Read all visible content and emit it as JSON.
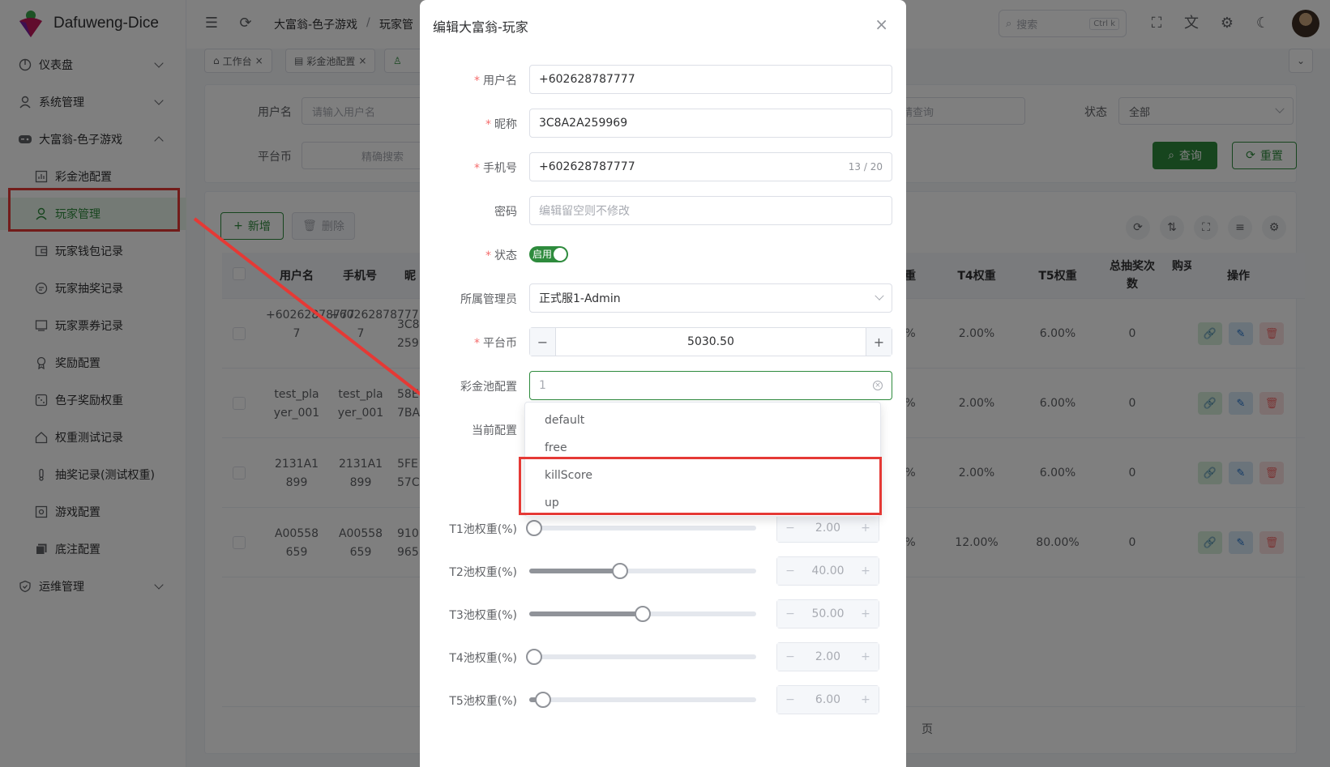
{
  "app": {
    "title": "Dafuweng-Dice"
  },
  "sidebar": {
    "items": [
      {
        "label": "仪表盘",
        "icon": "dashboard-icon"
      },
      {
        "label": "系统管理",
        "icon": "user-icon"
      },
      {
        "label": "大富翁-色子游戏",
        "icon": "gamepad-icon"
      },
      {
        "label": "彩金池配置",
        "icon": "chart-icon"
      },
      {
        "label": "玩家管理",
        "icon": "user-icon"
      },
      {
        "label": "玩家钱包记录",
        "icon": "wallet-icon"
      },
      {
        "label": "玩家抽奖记录",
        "icon": "record-icon"
      },
      {
        "label": "玩家票券记录",
        "icon": "ticket-icon"
      },
      {
        "label": "奖励配置",
        "icon": "award-icon"
      },
      {
        "label": "色子奖励权重",
        "icon": "dice-icon"
      },
      {
        "label": "权重测试记录",
        "icon": "home-icon"
      },
      {
        "label": "抽奖记录(测试权重)",
        "icon": "thermometer-icon"
      },
      {
        "label": "游戏配置",
        "icon": "settings-icon"
      },
      {
        "label": "底注配置",
        "icon": "copy-icon"
      },
      {
        "label": "运维管理",
        "icon": "shield-icon"
      }
    ]
  },
  "header": {
    "breadcrumb": [
      "大富翁-色子游戏",
      "/",
      "玩家管"
    ],
    "search_placeholder": "搜索",
    "search_shortcut": "Ctrl k"
  },
  "tabs": [
    {
      "label": "工作台"
    },
    {
      "label": "彩金池配置"
    }
  ],
  "filters": {
    "username_label": "用户名",
    "username_placeholder": "请输入用户名",
    "hidden_placeholder": "精查询",
    "status_label": "状态",
    "status_value": "全部",
    "coin_label": "平台币",
    "coin_placeholder": "精确搜索",
    "query_button": "查询",
    "reset_button": "重置"
  },
  "toolbar": {
    "add_button": "新增",
    "delete_button": "删除"
  },
  "table": {
    "headers": {
      "username": "用户名",
      "phone": "手机号",
      "nick": "昵",
      "w3": "重",
      "t4": "T4权重",
      "t5": "T5权重",
      "total": "总抽奖次数",
      "buy": "购买",
      "ops": "操作"
    },
    "rows": [
      {
        "username": "+60262878777\n7",
        "phone": "+60262878777\n7",
        "nick": "3C8\n259",
        "w3": "%",
        "t4": "2.00%",
        "t5": "6.00%",
        "total": "0"
      },
      {
        "username": "test_pla\nyer_001",
        "phone": "test_pla\nyer_001",
        "nick": "58E\n7BA",
        "w3": "%",
        "t4": "2.00%",
        "t5": "6.00%",
        "total": "0"
      },
      {
        "username": "2131A1\n899",
        "phone": "2131A1\n899",
        "nick": "5FE\n57C",
        "w3": "%",
        "t4": "2.00%",
        "t5": "6.00%",
        "total": "0"
      },
      {
        "username": "A00558\n659",
        "phone": "A00558\n659",
        "nick": "910\n965",
        "w3": "%",
        "t4": "12.00%",
        "t5": "80.00%",
        "total": "0"
      }
    ],
    "pager_suffix": "页"
  },
  "dialog": {
    "title": "编辑大富翁-玩家",
    "username_label": "用户名",
    "username_value": "+602628787777",
    "nickname_label": "昵称",
    "nickname_value": "3C8A2A259969",
    "phone_label": "手机号",
    "phone_value": "+602628787777",
    "phone_counter": "13 / 20",
    "password_label": "密码",
    "password_placeholder": "编辑留空则不修改",
    "status_label": "状态",
    "status_switch_text": "启用",
    "admin_label": "所属管理员",
    "admin_value": "正式服1-Admin",
    "coin_label": "平台币",
    "coin_value": "5030.50",
    "jackpot_label": "彩金池配置",
    "jackpot_value": "1",
    "current_label": "当前配置",
    "sliders": [
      {
        "label": "T1池权重(%)",
        "value": "2.00",
        "fraction": 0.02
      },
      {
        "label": "T2池权重(%)",
        "value": "40.00",
        "fraction": 0.4
      },
      {
        "label": "T3池权重(%)",
        "value": "50.00",
        "fraction": 0.5
      },
      {
        "label": "T4池权重(%)",
        "value": "2.00",
        "fraction": 0.02
      },
      {
        "label": "T5池权重(%)",
        "value": "6.00",
        "fraction": 0.06
      }
    ]
  },
  "dropdown": {
    "options": [
      "default",
      "free",
      "killScore",
      "up"
    ]
  },
  "colors": {
    "accent": "#2e8b3d",
    "highlight": "#e53935",
    "danger": "#f56c6c"
  }
}
